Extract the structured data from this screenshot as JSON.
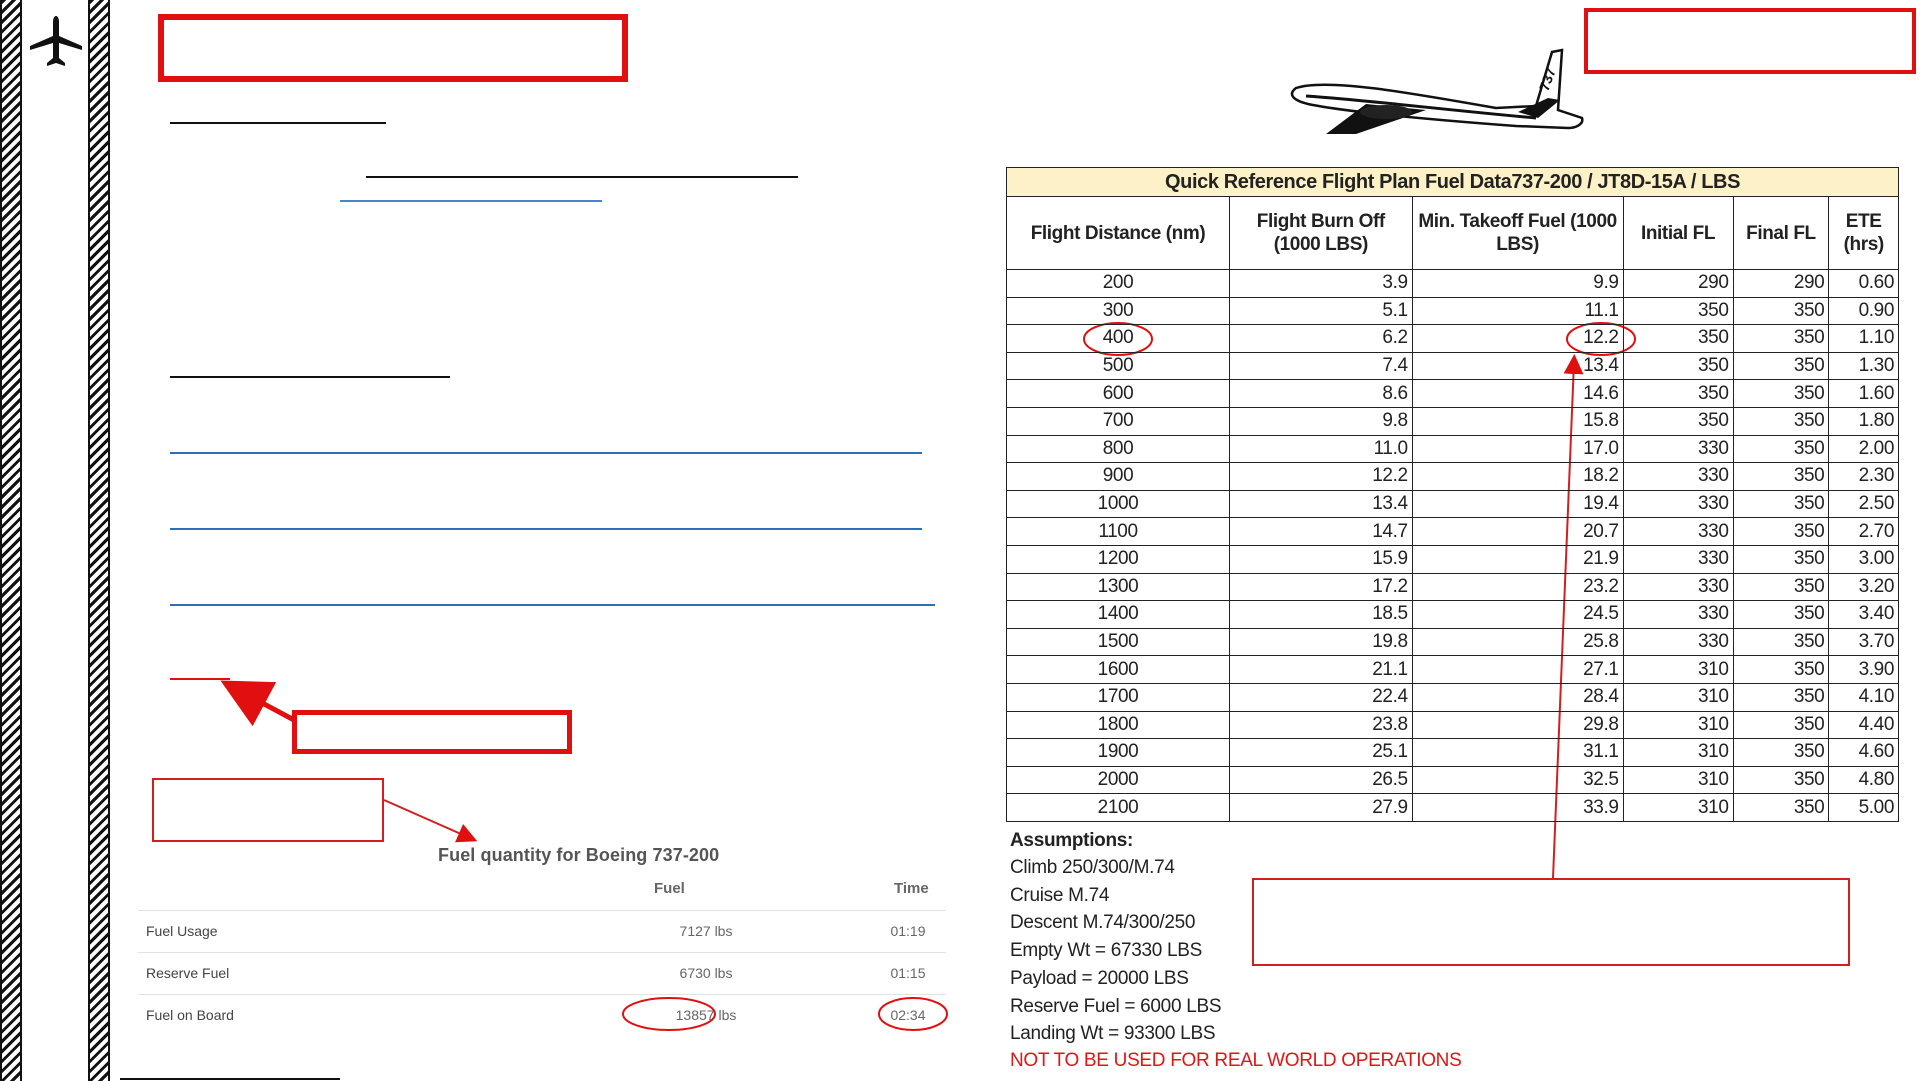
{
  "rail": {
    "icon": "airplane-icon"
  },
  "fuel_widget": {
    "title": "Fuel quantity for Boeing 737-200",
    "col_fuel": "Fuel",
    "col_time": "Time",
    "rows": [
      {
        "label": "Fuel Usage",
        "fuel": "7127 lbs",
        "time": "01:19"
      },
      {
        "label": "Reserve Fuel",
        "fuel": "6730 lbs",
        "time": "01:15"
      },
      {
        "label": "Fuel on Board",
        "fuel": "13857 lbs",
        "time": "02:34"
      }
    ]
  },
  "table": {
    "caption": "Quick Reference Flight Plan Fuel Data737-200 / JT8D-15A / LBS",
    "headers": [
      "Flight Distance (nm)",
      "Flight Burn Off (1000 LBS)",
      "Min. Takeoff Fuel (1000 LBS)",
      "Initial FL",
      "Final FL",
      "ETE (hrs)"
    ],
    "rows": [
      [
        "200",
        "3.9",
        "9.9",
        "290",
        "290",
        "0.60"
      ],
      [
        "300",
        "5.1",
        "11.1",
        "350",
        "350",
        "0.90"
      ],
      [
        "400",
        "6.2",
        "12.2",
        "350",
        "350",
        "1.10"
      ],
      [
        "500",
        "7.4",
        "13.4",
        "350",
        "350",
        "1.30"
      ],
      [
        "600",
        "8.6",
        "14.6",
        "350",
        "350",
        "1.60"
      ],
      [
        "700",
        "9.8",
        "15.8",
        "350",
        "350",
        "1.80"
      ],
      [
        "800",
        "11.0",
        "17.0",
        "330",
        "350",
        "2.00"
      ],
      [
        "900",
        "12.2",
        "18.2",
        "330",
        "350",
        "2.30"
      ],
      [
        "1000",
        "13.4",
        "19.4",
        "330",
        "350",
        "2.50"
      ],
      [
        "1100",
        "14.7",
        "20.7",
        "330",
        "350",
        "2.70"
      ],
      [
        "1200",
        "15.9",
        "21.9",
        "330",
        "350",
        "3.00"
      ],
      [
        "1300",
        "17.2",
        "23.2",
        "330",
        "350",
        "3.20"
      ],
      [
        "1400",
        "18.5",
        "24.5",
        "330",
        "350",
        "3.40"
      ],
      [
        "1500",
        "19.8",
        "25.8",
        "330",
        "350",
        "3.70"
      ],
      [
        "1600",
        "21.1",
        "27.1",
        "310",
        "350",
        "3.90"
      ],
      [
        "1700",
        "22.4",
        "28.4",
        "310",
        "350",
        "4.10"
      ],
      [
        "1800",
        "23.8",
        "29.8",
        "310",
        "350",
        "4.40"
      ],
      [
        "1900",
        "25.1",
        "31.1",
        "310",
        "350",
        "4.60"
      ],
      [
        "2000",
        "26.5",
        "32.5",
        "310",
        "350",
        "4.80"
      ],
      [
        "2100",
        "27.9",
        "33.9",
        "310",
        "350",
        "5.00"
      ]
    ]
  },
  "assumptions": {
    "heading": "Assumptions:",
    "lines": [
      "Climb 250/300/M.74",
      "Cruise M.74",
      "Descent M.74/300/250",
      "Empty Wt = 67330 LBS",
      "Payload = 20000 LBS",
      "Reserve Fuel = 6000 LBS",
      "Landing Wt = 93300 LBS"
    ],
    "warning": "NOT TO BE USED FOR REAL WORLD OPERATIONS"
  },
  "plane_image": {
    "tail_text": "737"
  },
  "colors": {
    "annotation_red": "#e01010",
    "link_blue": "#2e6fb8",
    "caption_bg": "#fdf2c7"
  }
}
